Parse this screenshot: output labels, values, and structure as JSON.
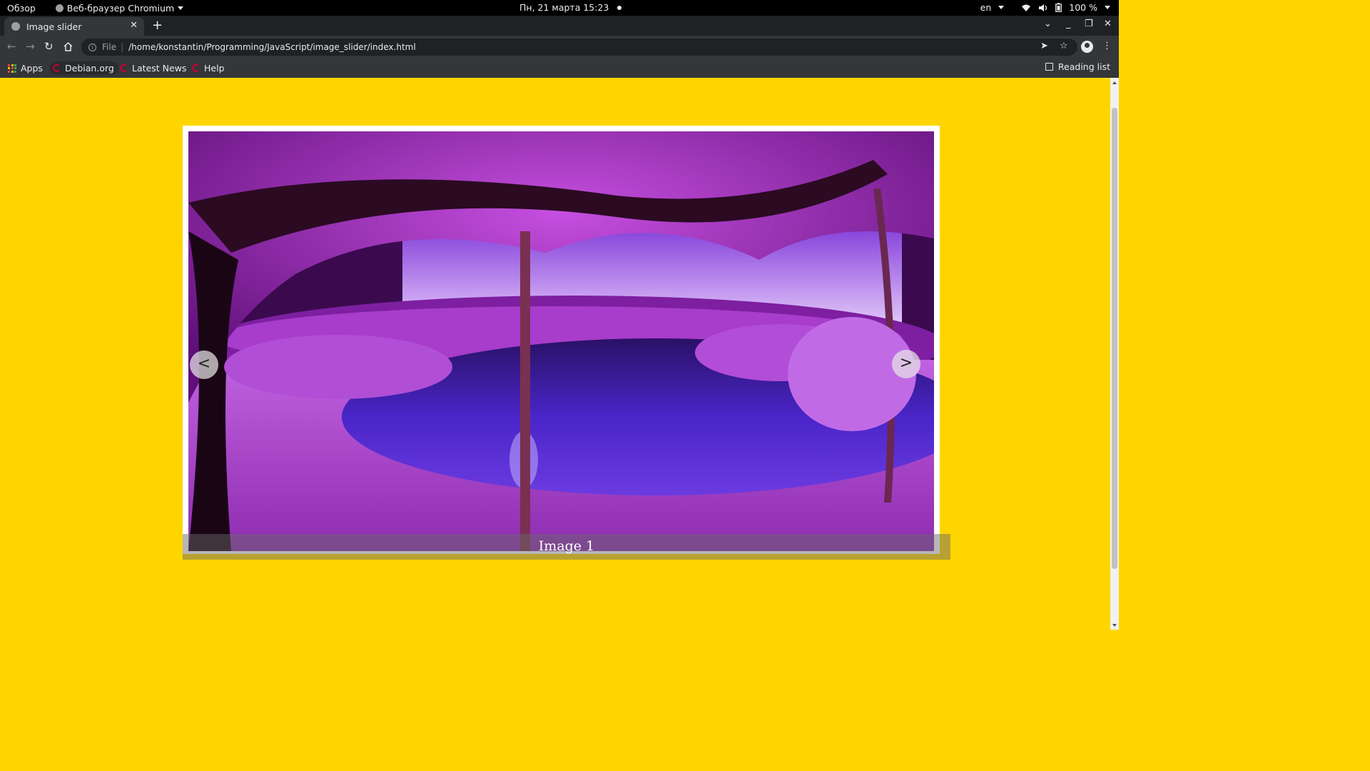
{
  "system_bar": {
    "activities": "Обзор",
    "app_name": "Веб-браузер Chromium",
    "clock": "Пн, 21 марта  15:23",
    "keyboard_layout": "en",
    "battery": "100 %"
  },
  "browser": {
    "tab_title": "Image slider",
    "url_scheme": "File",
    "url": "/home/konstantin/Programming/JavaScript/image_slider/index.html",
    "bookmarks": [
      {
        "label": "Apps"
      },
      {
        "label": "Debian.org"
      },
      {
        "label": "Latest News"
      },
      {
        "label": "Help"
      }
    ],
    "reading_list": "Reading list"
  },
  "slider": {
    "caption": "Image 1",
    "prev_label": "<",
    "next_label": ">",
    "image_description_icon": "photo-infrared-purple-garden-pond"
  },
  "colors": {
    "page_background": "#ffd500",
    "frame": "#ffffff"
  }
}
